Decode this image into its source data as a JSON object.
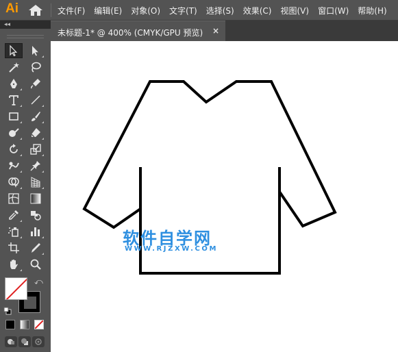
{
  "app": {
    "logo": "Ai"
  },
  "menu": [
    "文件(F)",
    "编辑(E)",
    "对象(O)",
    "文字(T)",
    "选择(S)",
    "效果(C)",
    "视图(V)",
    "窗口(W)",
    "帮助(H)"
  ],
  "document_tab": {
    "title": "未标题-1* @ 400% (CMYK/GPU 预览)",
    "close": "×"
  },
  "panel": {
    "collapse": "◂◂"
  },
  "toolbar": {
    "tools": [
      {
        "name": "selection-tool",
        "icon": "arrow-outline-icon",
        "active": true
      },
      {
        "name": "direct-selection-tool",
        "icon": "arrow-solid-icon"
      },
      {
        "name": "magic-wand-tool",
        "icon": "magic-wand-icon"
      },
      {
        "name": "lasso-tool",
        "icon": "lasso-icon"
      },
      {
        "name": "pen-tool",
        "icon": "pen-icon"
      },
      {
        "name": "curvature-tool",
        "icon": "curvature-pen-icon"
      },
      {
        "name": "type-tool",
        "icon": "type-icon"
      },
      {
        "name": "line-tool",
        "icon": "line-icon"
      },
      {
        "name": "rectangle-tool",
        "icon": "rectangle-icon"
      },
      {
        "name": "paintbrush-tool",
        "icon": "brush-icon"
      },
      {
        "name": "shaper-tool",
        "icon": "shaper-icon"
      },
      {
        "name": "eraser-tool",
        "icon": "eraser-icon"
      },
      {
        "name": "rotate-tool",
        "icon": "rotate-icon"
      },
      {
        "name": "scale-tool",
        "icon": "scale-icon"
      },
      {
        "name": "warp-tool",
        "icon": "warp-icon"
      },
      {
        "name": "puppet-warp-tool",
        "icon": "pin-icon"
      },
      {
        "name": "shape-builder-tool",
        "icon": "shape-builder-icon"
      },
      {
        "name": "perspective-grid-tool",
        "icon": "perspective-grid-icon"
      },
      {
        "name": "mesh-tool",
        "icon": "mesh-icon"
      },
      {
        "name": "gradient-tool",
        "icon": "gradient-icon"
      },
      {
        "name": "eyedropper-tool",
        "icon": "eyedropper-icon"
      },
      {
        "name": "blend-tool",
        "icon": "blend-icon"
      },
      {
        "name": "symbol-sprayer-tool",
        "icon": "symbol-sprayer-icon"
      },
      {
        "name": "column-graph-tool",
        "icon": "bar-graph-icon"
      },
      {
        "name": "artboard-tool",
        "icon": "artboard-icon"
      },
      {
        "name": "slice-tool",
        "icon": "slice-icon"
      },
      {
        "name": "hand-tool",
        "icon": "hand-icon"
      },
      {
        "name": "zoom-tool",
        "icon": "zoom-icon"
      }
    ],
    "fill": "#ffffff",
    "stroke": "#000000"
  },
  "canvas": {
    "watermark": "软件自学网",
    "watermark_url": "WWW.RJZXW.COM",
    "watermark_color": "#2e8fe0"
  },
  "colors": {
    "menubar_bg": "#535353",
    "toolbar_bg": "#535353",
    "canvas_bg": "#ffffff",
    "logo": "#ff9a00"
  }
}
